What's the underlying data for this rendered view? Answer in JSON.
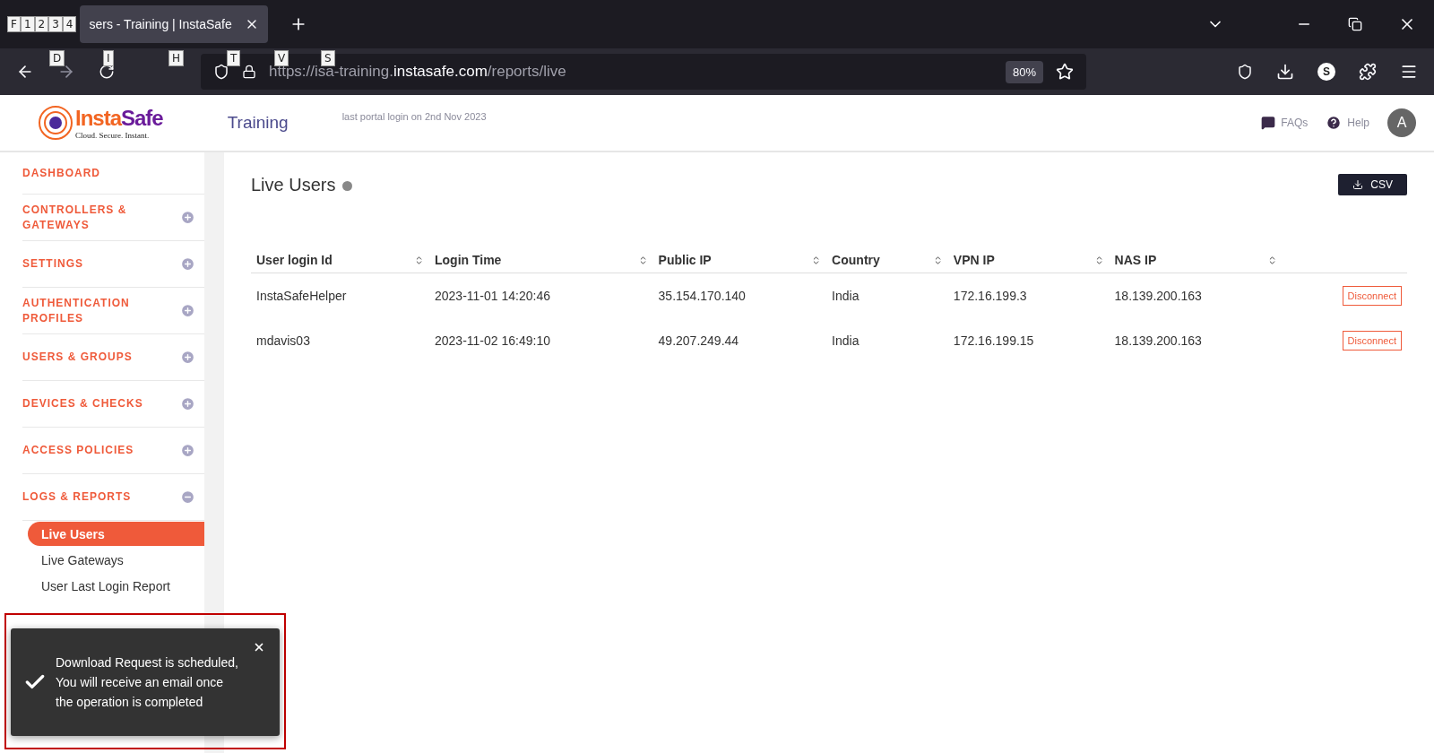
{
  "browser": {
    "hints": [
      {
        "key": "F"
      },
      {
        "key": "1"
      },
      {
        "key": "2"
      },
      {
        "key": "3"
      },
      {
        "key": "4"
      }
    ],
    "tab": {
      "title": "sers - Training | InstaSafe",
      "selected": true
    },
    "nav_hints": [
      "D",
      "I",
      "H",
      "T",
      "V",
      "S"
    ],
    "url": {
      "scheme": "https://isa-training.",
      "domain": "instasafe.com",
      "path": "/reports/live"
    },
    "zoom": "80%",
    "profile_initial": "S"
  },
  "header": {
    "logo": {
      "name_part1": "Insta",
      "name_part2": "Safe",
      "tagline": "Cloud. Secure. Instant."
    },
    "tenant": "Training",
    "last_login": "last portal login on 2nd Nov 2023",
    "links": [
      {
        "label": "FAQs",
        "kind": "faq"
      },
      {
        "label": "Help",
        "kind": "help"
      }
    ],
    "avatar": "A"
  },
  "sidebar": {
    "items": [
      {
        "label": "DASHBOARD",
        "kind": "link"
      },
      {
        "label": "CONTROLLERS & GATEWAYS",
        "kind": "section",
        "expanded": false
      },
      {
        "label": "SETTINGS",
        "kind": "section",
        "expanded": false
      },
      {
        "label": "AUTHENTICATION PROFILES",
        "kind": "section",
        "expanded": false
      },
      {
        "label": "USERS & GROUPS",
        "kind": "section",
        "expanded": false
      },
      {
        "label": "DEVICES & CHECKS",
        "kind": "section",
        "expanded": false
      },
      {
        "label": "ACCESS POLICIES",
        "kind": "section",
        "expanded": false
      },
      {
        "label": "LOGS & REPORTS",
        "kind": "section",
        "expanded": true,
        "children": [
          {
            "label": "Live Users",
            "selected": true
          },
          {
            "label": "Live Gateways",
            "selected": false
          },
          {
            "label": "User Last Login Report",
            "selected": false
          }
        ]
      }
    ]
  },
  "page": {
    "title": "Live Users",
    "export_button": "CSV",
    "table": {
      "columns": [
        "User login Id",
        "Login Time",
        "Public IP",
        "Country",
        "VPN IP",
        "NAS IP"
      ],
      "rows": [
        {
          "cells": [
            "InstaSafeHelper",
            "2023-11-01 14:20:46",
            "35.154.170.140",
            "India",
            "172.16.199.3",
            "18.139.200.163"
          ],
          "action": "Disconnect"
        },
        {
          "cells": [
            "mdavis03",
            "2023-11-02 16:49:10",
            "49.207.249.44",
            "India",
            "172.16.199.15",
            "18.139.200.163"
          ],
          "action": "Disconnect"
        }
      ]
    }
  },
  "toast": {
    "message": "Download Request is scheduled, You will receive an email once the operation is completed",
    "highlighted": true
  }
}
